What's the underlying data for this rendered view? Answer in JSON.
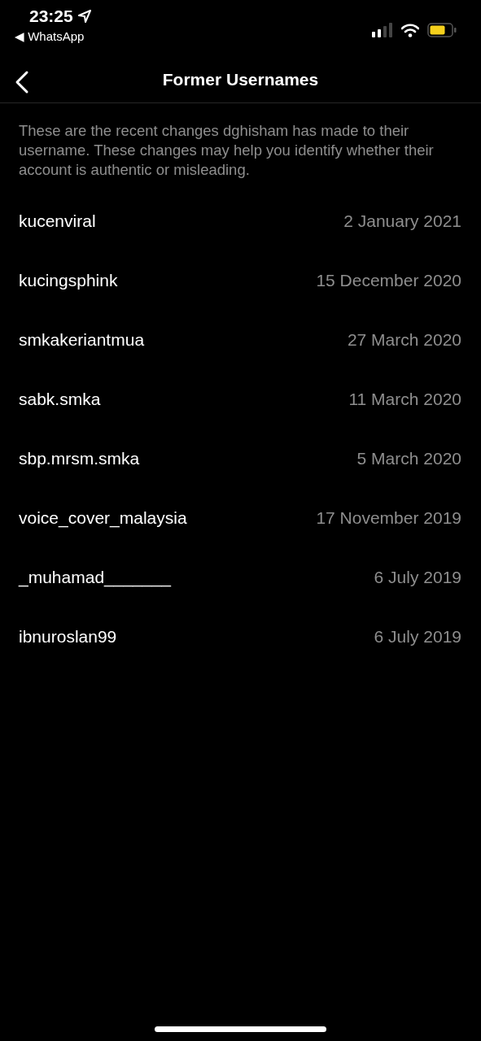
{
  "status_bar": {
    "time": "23:25",
    "back_app": "◀ WhatsApp"
  },
  "nav": {
    "title": "Former Usernames"
  },
  "description": "These are the recent changes dghisham has made to their username. These changes may help you identify whether their account is authentic or misleading.",
  "usernames": [
    {
      "name": "kucenviral",
      "date": "2 January 2021"
    },
    {
      "name": "kucingsphink",
      "date": "15 December 2020"
    },
    {
      "name": "smkakeriantmua",
      "date": "27 March 2020"
    },
    {
      "name": "sabk.smka",
      "date": "11 March 2020"
    },
    {
      "name": "sbp.mrsm.smka",
      "date": "5 March 2020"
    },
    {
      "name": "voice_cover_malaysia",
      "date": "17 November 2019"
    },
    {
      "name": "_muhamad_______",
      "date": "6 July 2019"
    },
    {
      "name": "ibnuroslan99",
      "date": "6 July 2019"
    }
  ]
}
